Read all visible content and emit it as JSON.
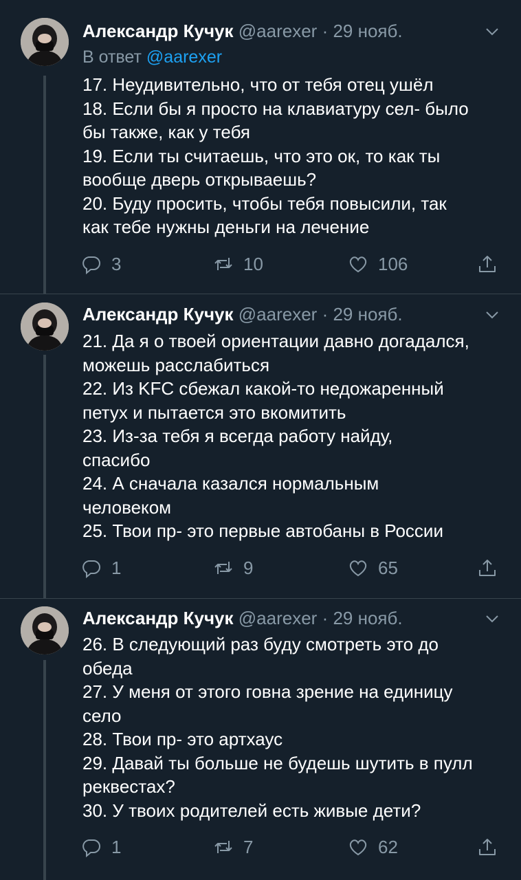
{
  "tweets": [
    {
      "author_name": "Александр Кучук",
      "handle": "@aarexer",
      "separator": "·",
      "date": "29 нояб.",
      "reply_prefix": "В ответ",
      "reply_mention": "@aarexer",
      "lines": [
        "17. Неудивительно, что от тебя отец ушёл",
        "18. Если бы я просто на клавиатуру сел- было",
        "бы также, как у тебя",
        "19. Если ты считаешь, что это ок, то как ты",
        "вообще дверь открываешь?",
        "20. Буду просить, чтобы тебя повысили, так",
        "как тебе нужны деньги на лечение"
      ],
      "replies": "3",
      "retweets": "10",
      "likes": "106"
    },
    {
      "author_name": "Александр Кучук",
      "handle": "@aarexer",
      "separator": "·",
      "date": "29 нояб.",
      "lines": [
        "21. Да я о твоей ориентации давно догадался,",
        "можешь расслабиться",
        "22. Из KFC сбежал какой-то недожаренный",
        "петух и пытается это вкомитить",
        "23. Из-за тебя я всегда работу найду,",
        "спасибо",
        "24. А сначала казался нормальным",
        "человеком",
        "25. Твои пр- это первые автобаны в России"
      ],
      "replies": "1",
      "retweets": "9",
      "likes": "65"
    },
    {
      "author_name": "Александр Кучук",
      "handle": "@aarexer",
      "separator": "·",
      "date": "29 нояб.",
      "lines": [
        "26. В следующий раз буду смотреть это до",
        "обеда",
        "27. У меня от этого говна зрение на единицу",
        "село",
        "28. Твои пр- это артхаус",
        "29. Давай ты больше не будешь шутить в пулл",
        "реквестах?",
        "30. У твоих родителей есть живые дети?"
      ],
      "replies": "1",
      "retweets": "7",
      "likes": "62"
    }
  ],
  "icons": {
    "reply": "reply-icon",
    "retweet": "retweet-icon",
    "like": "heart-icon",
    "share": "share-icon",
    "more": "chevron-down-icon"
  },
  "colors": {
    "background": "#15202b",
    "secondary_text": "#8899a6",
    "link": "#1da1f2",
    "thread_line": "#38444d"
  }
}
